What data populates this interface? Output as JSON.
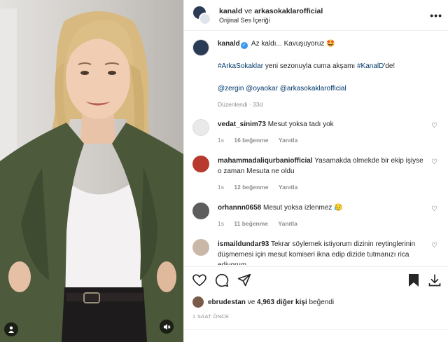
{
  "header": {
    "account1": "kanald",
    "connector": "ve",
    "account2": "arkasokaklarofficial",
    "audio": "Orijinal Ses İçeriği",
    "more_icon": "more-icon"
  },
  "caption": {
    "username": "kanald",
    "verified_icon": "verified-badge-icon",
    "line1": "Az kaldı... Kavuşuyoruz 🤩",
    "hashtag1": "#ArkaSokaklar",
    "line2_mid": "yeni sezonuyla cuma akşamı",
    "hashtag2": "#KanalD",
    "line2_end": "'de!",
    "mention1": "@zergin",
    "mention2": "@oyaokar",
    "mention3": "@arkasokaklarofficial",
    "edited": "Düzenlendi",
    "sep": "·",
    "age": "33d"
  },
  "comments": [
    {
      "user": "vedat_sinim73",
      "text": "Mesut yoksa tadı yok",
      "time": "1s",
      "likes": "16 beğenme",
      "reply": "Yanıtla",
      "avatar_color": "#e9e9e9"
    },
    {
      "user": "mahammadaliqurbaniofficial",
      "text": "Yasamakda olmekde bir ekip işiyse o zaman Mesuta ne oldu",
      "time": "1s",
      "likes": "12 beğenme",
      "reply": "Yanıtla",
      "avatar_color": "#b83a2e"
    },
    {
      "user": "orhannn0658",
      "text": "Mesut yoksa izlenmez 😥",
      "time": "1s",
      "likes": "11 beğenme",
      "reply": "Yanıtla",
      "avatar_color": "#5d5d5d"
    },
    {
      "user": "ismaildundar93",
      "text": "Tekrar söylemek istiyorum dizinin reytinglerinin düşmemesi için mesut komiseri ikna edip dizide tutmanızı rica ediyorum.",
      "time": "",
      "likes": "",
      "reply": "",
      "avatar_color": "#c9b8a8"
    }
  ],
  "actions": {
    "like_icon": "heart-icon",
    "comment_icon": "comment-icon",
    "share_icon": "send-icon",
    "save_icon": "bookmark-icon",
    "download_icon": "download-icon"
  },
  "likes": {
    "first_user": "ebrudestan",
    "and": "ve",
    "others": "4,963 diğer kişi",
    "liked": "beğendi"
  },
  "time": "1 SAAT ÖNCE",
  "media": {
    "audio_icon": "user-tag-icon",
    "mute_icon": "speaker-muted-icon"
  },
  "colors": {
    "link": "#00376b",
    "muted": "#8e8e8e",
    "verified": "#3897f0",
    "jacket": "#4d5a3c",
    "hair": "#d8b980"
  }
}
